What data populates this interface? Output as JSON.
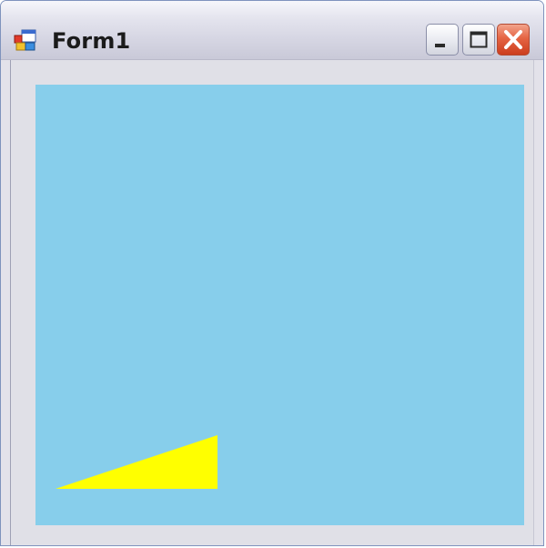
{
  "window": {
    "title": "Form1",
    "app_icon": "form-app-icon",
    "controls": {
      "minimize_icon": "minimize-icon",
      "maximize_icon": "maximize-icon",
      "close_icon": "close-icon"
    }
  },
  "canvas": {
    "background_color": "#87ceeb",
    "shape": {
      "kind": "triangle",
      "fill_color": "#ffff00"
    }
  },
  "colors": {
    "client_background": "#e0e0e7",
    "close_button": "#e05a38"
  }
}
